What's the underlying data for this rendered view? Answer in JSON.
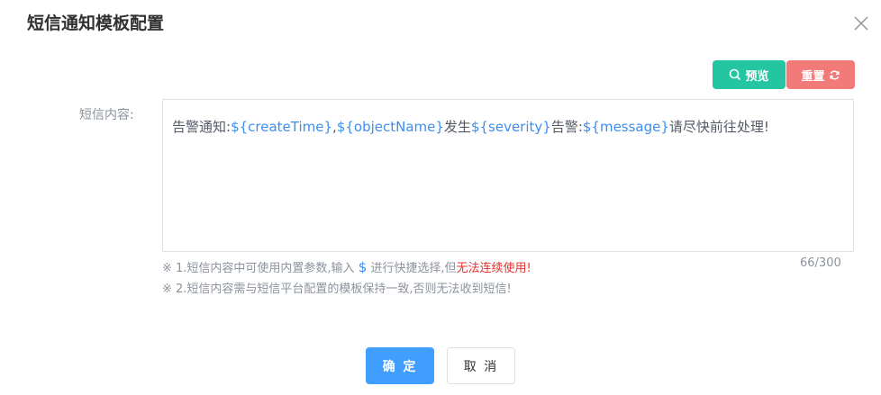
{
  "dialog": {
    "title": "短信通知模板配置",
    "close_icon": "close-icon"
  },
  "toolbar": {
    "preview_label": "预览",
    "preview_icon": "search-icon",
    "reset_label": "重置",
    "reset_icon": "refresh-icon"
  },
  "form": {
    "label": "短信内容:",
    "content": [
      {
        "text": "告警通知:",
        "param": false
      },
      {
        "text": "${createTime}",
        "param": true
      },
      {
        "text": ",",
        "param": false
      },
      {
        "text": "${objectName}",
        "param": true
      },
      {
        "text": "发生",
        "param": false
      },
      {
        "text": "${severity}",
        "param": true
      },
      {
        "text": "告警:",
        "param": false
      },
      {
        "text": "${message}",
        "param": true
      },
      {
        "text": "请尽快前往处理!",
        "param": false
      }
    ],
    "counter": "66/300"
  },
  "notes": {
    "n1_prefix": "※ 1.短信内容中可使用内置参数,输入 ",
    "n1_symbol": "$",
    "n1_mid": " 进行快捷选择,但",
    "n1_warn": "无法连续使用!",
    "n2": "※ 2.短信内容需与短信平台配置的模板保持一致,否则无法收到短信!"
  },
  "footer": {
    "ok_label": "确 定",
    "cancel_label": "取 消"
  },
  "colors": {
    "preview": "#23c6a0",
    "reset": "#f27a79",
    "primary": "#409eff",
    "param": "#3d8ef0",
    "warn": "#e8312d"
  }
}
